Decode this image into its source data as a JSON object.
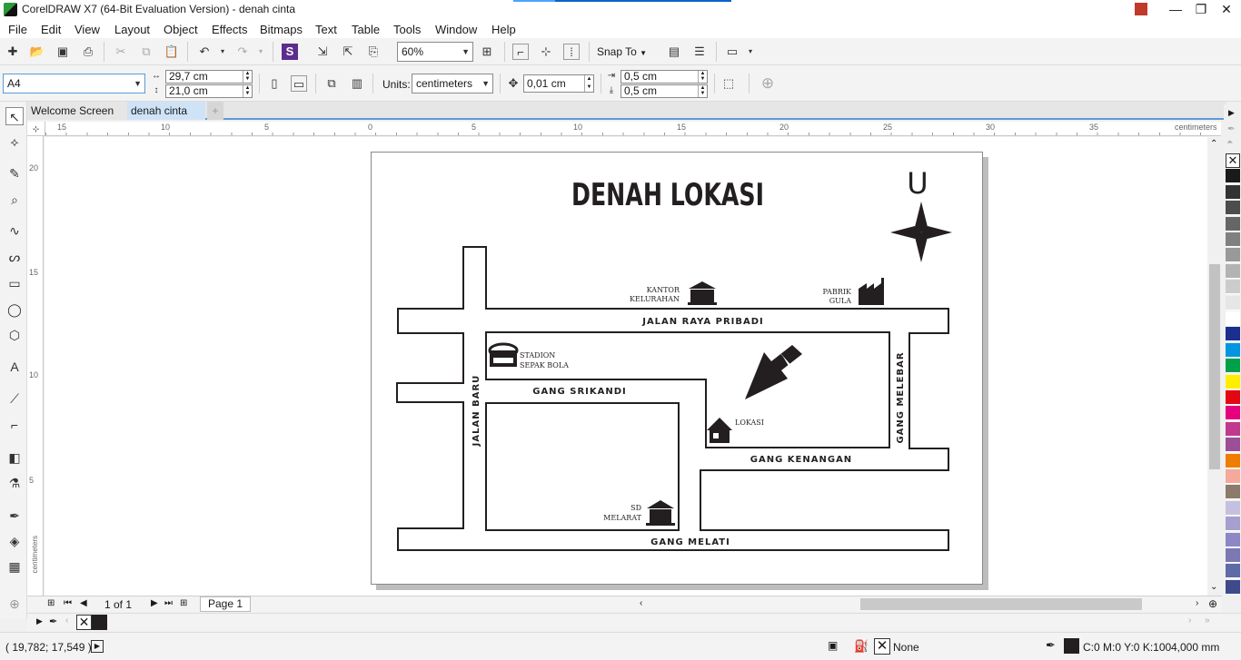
{
  "window": {
    "title": "CorelDRAW X7 (64-Bit Evaluation Version) - denah cinta",
    "minimize": "—",
    "restore": "❐",
    "close": "✕"
  },
  "menu": [
    "File",
    "Edit",
    "View",
    "Layout",
    "Object",
    "Effects",
    "Bitmaps",
    "Text",
    "Table",
    "Tools",
    "Window",
    "Help"
  ],
  "standard_toolbar": {
    "zoom_level": "60%",
    "snap_to": "Snap To"
  },
  "property_bar": {
    "page_size": "A4",
    "width": "29,7 cm",
    "height": "21,0 cm",
    "units_label": "Units:",
    "units": "centimeters",
    "nudge": "0,01 cm",
    "dup_x": "0,5 cm",
    "dup_y": "0,5 cm"
  },
  "tabs": [
    {
      "label": "Welcome Screen"
    },
    {
      "label": "denah cinta"
    }
  ],
  "ruler": {
    "unit": "centimeters",
    "h_ticks": [
      "15",
      "10",
      "5",
      "0",
      "5",
      "10",
      "15",
      "20",
      "25",
      "30",
      "35"
    ],
    "v_ticks": [
      "20",
      "15",
      "10",
      "5"
    ],
    "v_unit": "centimeters"
  },
  "map": {
    "title": "DENAH LOKASI",
    "north": "U",
    "roads": {
      "raya": "JALAN RAYA PRIBADI",
      "srikandi": "GANG SRIKANDI",
      "baru": "JALAN BARU",
      "melebar": "GANG MELEBAR",
      "kenangan": "GANG KENANGAN",
      "melati": "GANG MELATI"
    },
    "places": {
      "kantor_1": "KANTOR",
      "kantor_2": "KELURAHAN",
      "pabrik_1": "PABRIK",
      "pabrik_2": "GULA",
      "stadion_1": "STADION",
      "stadion_2": "SEPAK BOLA",
      "lokasi": "LOKASI",
      "sd_1": "SD",
      "sd_2": "MELARAT"
    }
  },
  "page_nav": {
    "page_count": "1 of 1",
    "page_tab": "Page 1"
  },
  "status": {
    "coords": "( 19,782; 17,549 )",
    "fill": "None",
    "outline_color": "C:0 M:0 Y:0 K:100",
    "outline_width": "4,000 mm"
  },
  "palette_colors": [
    "#ffffff",
    "#1a1a1a",
    "#333333",
    "#4d4d4d",
    "#666666",
    "#808080",
    "#999999",
    "#b3b3b3",
    "#cccccc",
    "#e6e6e6",
    "#ffffff",
    "#1b2f8f",
    "#0096e0",
    "#00a04a",
    "#ffee00",
    "#e30613",
    "#e6007e",
    "#c0398f",
    "#9c4f96",
    "#ee7d00",
    "#f4a99b",
    "#8c7b6b",
    "#c6c0e0",
    "#a79fd0",
    "#8d87c6",
    "#7c78b4",
    "#5f6aa8",
    "#3e4a8c"
  ],
  "colors": {
    "accent": "#5b9bd5",
    "ink": "#231f20"
  }
}
